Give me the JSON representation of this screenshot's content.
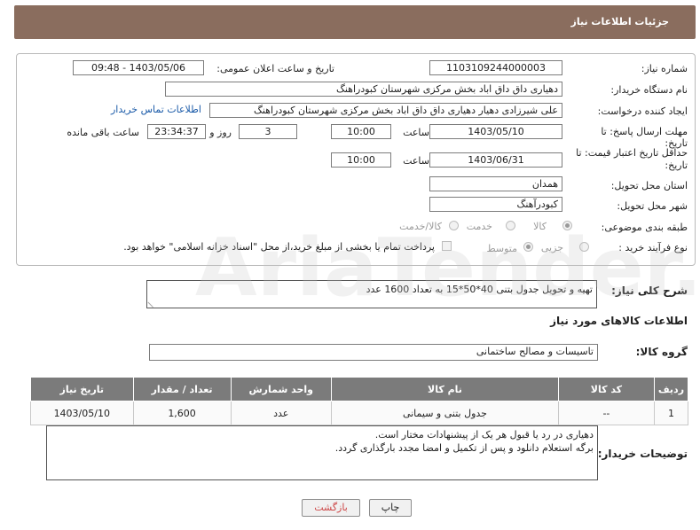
{
  "header": {
    "title": "جزئیات اطلاعات نیاز"
  },
  "form": {
    "need_number_label": "شماره نیاز:",
    "need_number": "1103109244000003",
    "announce_label": "تاریخ و ساعت اعلان عمومی:",
    "announce_value": "1403/05/06 - 09:48",
    "buyer_label": "نام دستگاه خریدار:",
    "buyer_value": "دهیاری داق داق اباد بخش مرکزی شهرستان کبودراهنگ",
    "creator_label": "ایجاد کننده درخواست:",
    "creator_value": "علی شیرزادی دهیار دهیاری داق داق اباد بخش مرکزی شهرستان کبودراهنگ",
    "contact_link": "اطلاعات تماس خریدار",
    "deadline_label_1": "مهلت ارسال پاسخ: تا",
    "deadline_label_2": "تاریخ:",
    "deadline_date": "1403/05/10",
    "time_label": "ساعت",
    "deadline_time": "10:00",
    "days_value": "3",
    "days_label": "روز و",
    "remaining_value": "23:34:37",
    "remaining_label": "ساعت باقی مانده",
    "validity_label_1": "حداقل تاریخ اعتبار قیمت: تا",
    "validity_label_2": "تاریخ:",
    "validity_date": "1403/06/31",
    "validity_time": "10:00",
    "province_label": "استان محل تحویل:",
    "province_value": "همدان",
    "city_label": "شهر محل تحویل:",
    "city_value": "کبودرآهنگ",
    "category_label": "طبقه بندی موضوعی:",
    "category_options": [
      "کالا",
      "خدمت",
      "کالا/خدمت"
    ],
    "process_label": "نوع فرآیند خرید :",
    "process_options": [
      "جزیی",
      "متوسط"
    ],
    "process_note": "پرداخت تمام یا بخشی از مبلغ خرید،از محل \"اسناد خزانه اسلامی\" خواهد بود."
  },
  "summary": {
    "label": "شرح کلی نیاز:",
    "value": "تهیه و تحویل جدول بتنی 40*50*15 به تعداد 1600 عدد"
  },
  "goods_info": {
    "title": "اطلاعات کالاهای مورد نیاز"
  },
  "goods_group": {
    "label": "گروه کالا:",
    "value": "تاسیسات و مصالح ساختمانی"
  },
  "table": {
    "headers": [
      "ردیف",
      "کد کالا",
      "نام کالا",
      "واحد شمارش",
      "تعداد / مقدار",
      "تاریخ نیاز"
    ],
    "rows": [
      [
        "1",
        "--",
        "جدول بتنی و سیمانی",
        "عدد",
        "1,600",
        "1403/05/10"
      ]
    ]
  },
  "buyer_notes": {
    "label": "توضیحات خریدار:",
    "line1": "دهیاری در رد یا قبول هر یک از پیشنهادات مختار است.",
    "line2": "برگه استعلام دانلود و پس از تکمیل و امضا مجدد بارگذاری گردد."
  },
  "buttons": {
    "print": "چاپ",
    "back": "بازگشت"
  },
  "watermark": "AriaTender.neT"
}
